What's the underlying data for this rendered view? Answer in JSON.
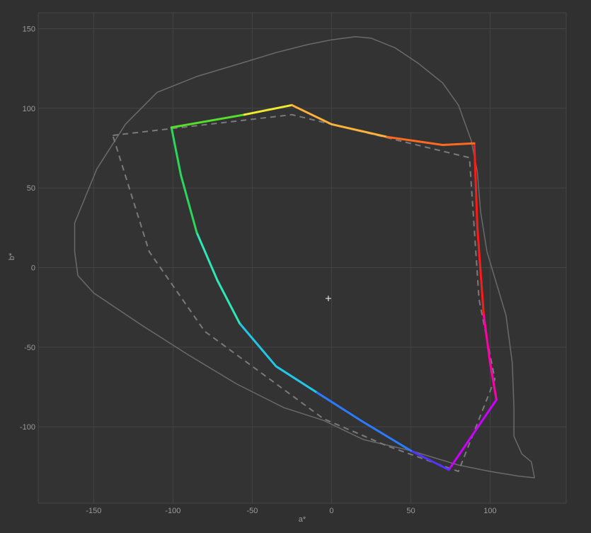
{
  "chart_data": {
    "type": "line",
    "title": "",
    "xlabel": "a*",
    "ylabel": "b*",
    "xlim": [
      -185,
      148
    ],
    "ylim": [
      -148,
      160
    ],
    "grid": true,
    "xticks": [
      -150,
      -100,
      -50,
      0,
      50,
      100
    ],
    "yticks": [
      -100,
      -50,
      0,
      50,
      100,
      150
    ],
    "x_tick_labels": [
      "-150",
      "-100",
      "-50",
      "0",
      "50",
      "100"
    ],
    "y_tick_labels": [
      "-100",
      "-50",
      "0",
      "50",
      "100",
      "150"
    ],
    "white_point_marker": {
      "x": -2,
      "y": -20,
      "symbol": "+"
    },
    "series": [
      {
        "style": "solid-thin",
        "color": "#6a6a6a",
        "points": [
          [
            -162,
            20
          ],
          [
            -162,
            28
          ],
          [
            -155,
            45
          ],
          [
            -148,
            62
          ],
          [
            -130,
            90
          ],
          [
            -110,
            110
          ],
          [
            -85,
            120
          ],
          [
            -58,
            128
          ],
          [
            -35,
            135
          ],
          [
            -15,
            140
          ],
          [
            0,
            143
          ],
          [
            15,
            145
          ],
          [
            25,
            144
          ],
          [
            40,
            138
          ],
          [
            55,
            128
          ],
          [
            70,
            116
          ],
          [
            80,
            102
          ],
          [
            88,
            80
          ],
          [
            92,
            60
          ],
          [
            94,
            35
          ],
          [
            98,
            10
          ],
          [
            104,
            -10
          ],
          [
            110,
            -30
          ],
          [
            114,
            -60
          ],
          [
            115,
            -88
          ],
          [
            115,
            -106
          ],
          [
            120,
            -117
          ],
          [
            126,
            -122
          ],
          [
            128,
            -132
          ],
          [
            118,
            -131
          ],
          [
            100,
            -128
          ],
          [
            80,
            -124
          ],
          [
            50,
            -115
          ],
          [
            20,
            -108
          ],
          [
            -5,
            -96
          ],
          [
            -30,
            -88
          ],
          [
            -60,
            -73
          ],
          [
            -90,
            -55
          ],
          [
            -120,
            -36
          ],
          [
            -150,
            -16
          ],
          [
            -160,
            -5
          ],
          [
            -162,
            10
          ],
          [
            -162,
            20
          ]
        ]
      },
      {
        "style": "dashed",
        "color": "#7a7a7a",
        "points": [
          [
            -138,
            83
          ],
          [
            -25,
            96
          ],
          [
            87,
            69
          ],
          [
            93,
            -20
          ],
          [
            103,
            -70
          ],
          [
            80,
            -128
          ],
          [
            35,
            -112
          ],
          [
            -5,
            -95
          ],
          [
            -80,
            -40
          ],
          [
            -115,
            10
          ],
          [
            -138,
            83
          ]
        ]
      },
      {
        "style": "gradient-thick",
        "segments": [
          {
            "color": "#ff1a1a",
            "points": [
              [
                90,
                78
              ],
              [
                92,
                25
              ],
              [
                96,
                -30
              ]
            ]
          },
          {
            "color": "#ff00aa",
            "points": [
              [
                96,
                -30
              ],
              [
                100,
                -60
              ],
              [
                104,
                -83
              ]
            ]
          },
          {
            "color": "#cc00ff",
            "points": [
              [
                104,
                -83
              ],
              [
                74,
                -127
              ]
            ]
          },
          {
            "color": "#5533ff",
            "points": [
              [
                74,
                -127
              ],
              [
                50,
                -115
              ]
            ]
          },
          {
            "color": "#2b7bff",
            "points": [
              [
                50,
                -115
              ],
              [
                20,
                -97
              ],
              [
                -10,
                -78
              ]
            ]
          },
          {
            "color": "#23c6e6",
            "points": [
              [
                -10,
                -78
              ],
              [
                -35,
                -62
              ],
              [
                -58,
                -35
              ]
            ]
          },
          {
            "color": "#2ee6b8",
            "points": [
              [
                -58,
                -35
              ],
              [
                -72,
                -8
              ],
              [
                -85,
                22
              ]
            ]
          },
          {
            "color": "#2ad75a",
            "points": [
              [
                -85,
                22
              ],
              [
                -95,
                58
              ],
              [
                -101,
                88
              ]
            ]
          },
          {
            "color": "#55e02a",
            "points": [
              [
                -101,
                88
              ],
              [
                -55,
                96
              ]
            ]
          },
          {
            "color": "#f2ea2e",
            "points": [
              [
                -55,
                96
              ],
              [
                -25,
                102
              ]
            ]
          },
          {
            "color": "#ffb23a",
            "points": [
              [
                -25,
                102
              ],
              [
                0,
                90
              ],
              [
                35,
                82
              ]
            ]
          },
          {
            "color": "#ff6a1f",
            "points": [
              [
                35,
                82
              ],
              [
                70,
                77
              ],
              [
                90,
                78
              ]
            ]
          }
        ]
      }
    ]
  }
}
